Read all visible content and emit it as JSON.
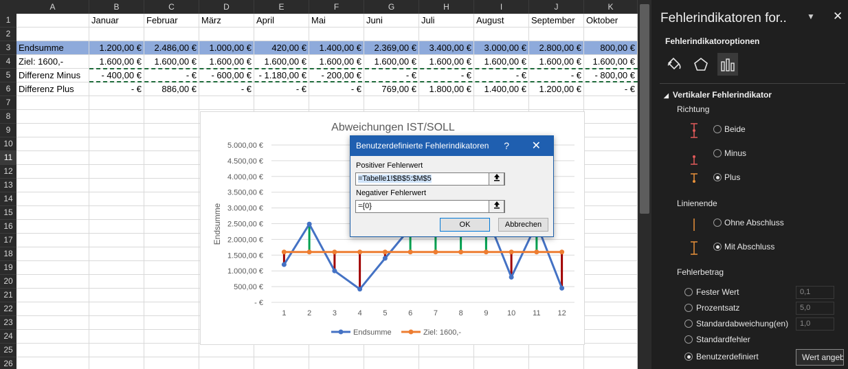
{
  "columns": [
    "A",
    "B",
    "C",
    "D",
    "E",
    "F",
    "G",
    "H",
    "I",
    "J",
    "K"
  ],
  "row_numbers": [
    "1",
    "2",
    "3",
    "4",
    "5",
    "6",
    "7",
    "8",
    "9",
    "10",
    "11",
    "12",
    "13",
    "14",
    "15",
    "16",
    "17",
    "18",
    "19",
    "20",
    "21",
    "22",
    "23",
    "24",
    "25",
    "26"
  ],
  "rows": [
    [
      "",
      "Januar",
      "Februar",
      "März",
      "April",
      "Mai",
      "Juni",
      "Juli",
      "August",
      "September",
      "Oktober"
    ],
    [
      "",
      "",
      "",
      "",
      "",
      "",
      "",
      "",
      "",
      "",
      ""
    ],
    [
      "Endsumme",
      "1.200,00 €",
      "2.486,00 €",
      "1.000,00 €",
      "420,00 €",
      "1.400,00 €",
      "2.369,00 €",
      "3.400,00 €",
      "3.000,00 €",
      "2.800,00 €",
      "800,00 €"
    ],
    [
      "Ziel: 1600,-",
      "1.600,00 €",
      "1.600,00 €",
      "1.600,00 €",
      "1.600,00 €",
      "1.600,00 €",
      "1.600,00 €",
      "1.600,00 €",
      "1.600,00 €",
      "1.600,00 €",
      "1.600,00 €"
    ],
    [
      "Differenz Minus",
      "-   400,00 €",
      "-      €",
      "-   600,00 €",
      "- 1.180,00 €",
      "-   200,00 €",
      "-      €",
      "-      €",
      "-      €",
      "-      €",
      "-   800,00 €"
    ],
    [
      "Differenz Plus",
      "-      €",
      "886,00 €",
      "-      €",
      "-      €",
      "-      €",
      "769,00 €",
      "1.800,00 €",
      "1.400,00 €",
      "1.200,00 €",
      "-      €"
    ]
  ],
  "chart_data": {
    "type": "line",
    "title": "Abweichungen IST/SOLL",
    "ylabel": "Endsumme",
    "xlabel": "",
    "x": [
      1,
      2,
      3,
      4,
      5,
      6,
      7,
      8,
      9,
      10,
      11,
      12
    ],
    "ylim": [
      0,
      5000
    ],
    "ytick_labels": [
      "5.000,00 €",
      "4.500,00 €",
      "4.000,00 €",
      "3.500,00 €",
      "3.000,00 €",
      "2.500,00 €",
      "2.000,00 €",
      "1.500,00 €",
      "1.000,00 €",
      "500,00 €",
      "-   €"
    ],
    "series": [
      {
        "name": "Endsumme",
        "color": "#4472c4",
        "values": [
          1200,
          2486,
          1000,
          420,
          1400,
          2369,
          3400,
          3000,
          2800,
          800,
          2500,
          450
        ]
      },
      {
        "name": "Ziel: 1600,-",
        "color": "#ed7d31",
        "values": [
          1600,
          1600,
          1600,
          1600,
          1600,
          1600,
          1600,
          1600,
          1600,
          1600,
          1600,
          1600
        ]
      }
    ],
    "error_bar_colors": {
      "minus": "#a00000",
      "plus": "#00a050"
    },
    "grid": true,
    "legend": "bottom"
  },
  "dialog": {
    "title": "Benutzerdefinierte Fehlerindikatoren",
    "help": "?",
    "close": "✕",
    "positive_label": "Positiver Fehlerwert",
    "positive_value": "=Tabelle1!$B$5:$M$5",
    "negative_label": "Negativer Fehlerwert",
    "negative_value": "={0}",
    "ok": "OK",
    "cancel": "Abbrechen"
  },
  "pane": {
    "title": "Fehlerindikatoren for..",
    "dropdown": "▼",
    "close": "✕",
    "subtitle": "Fehlerindikatoroptionen",
    "section": "Vertikaler Fehlerindikator",
    "direction_label": "Richtung",
    "direction": [
      "Beide",
      "Minus",
      "Plus"
    ],
    "endstyle_label": "Linienende",
    "endstyle": [
      "Ohne Abschluss",
      "Mit Abschluss"
    ],
    "amount_label": "Fehlerbetrag",
    "amount": [
      "Fester Wert",
      "Prozentsatz",
      "Standardabweichung(en)",
      "Standardfehler",
      "Benutzerdefiniert"
    ],
    "amount_values": [
      "0,1",
      "5,0",
      "1,0"
    ],
    "wert_button": "Wert angeben",
    "colors": {
      "bg": "#1f1f1f",
      "accent": "#e6e6e6",
      "icon_red": "#e05a5a",
      "icon_orange": "#e8913a"
    }
  }
}
